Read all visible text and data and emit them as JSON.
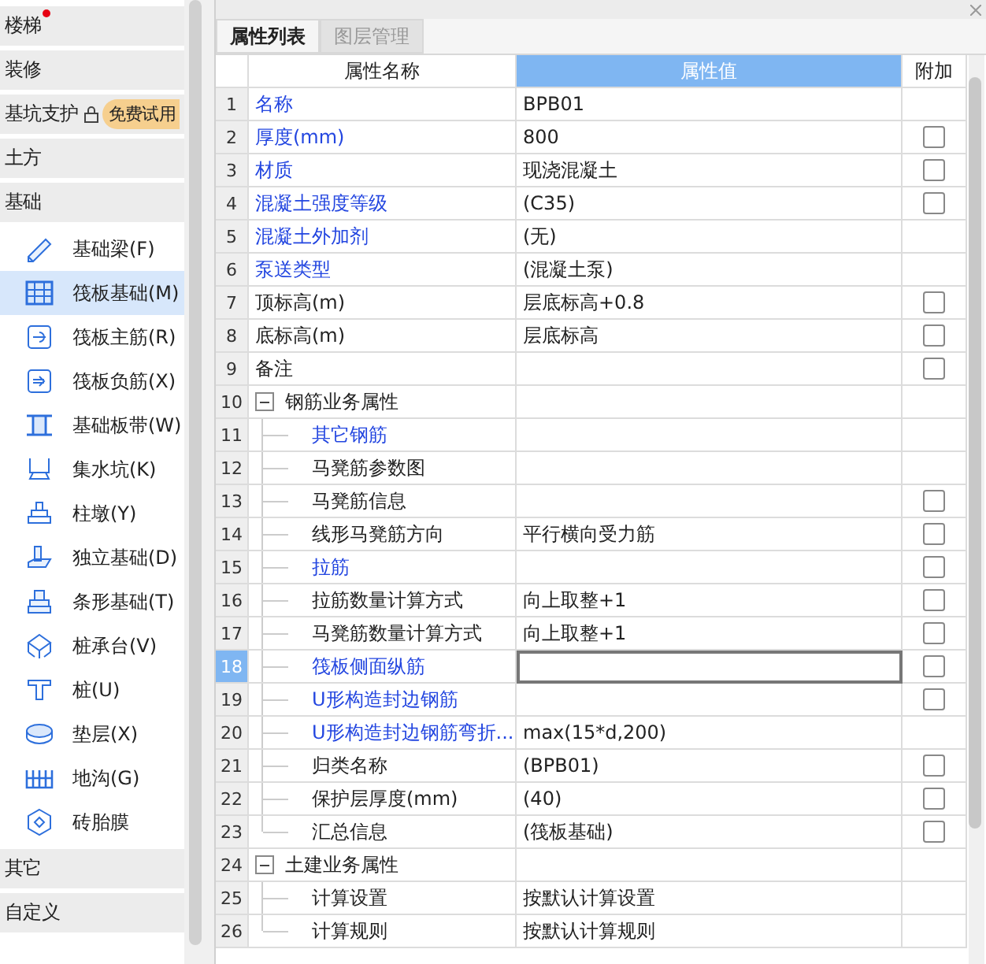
{
  "sidebar": {
    "categories": [
      {
        "label": "楼梯",
        "dot": true
      },
      {
        "label": "装修",
        "dot": false
      },
      {
        "label": "基坑支护",
        "dot": false,
        "locked": true,
        "badge": "免费试用"
      },
      {
        "label": "土方",
        "dot": false
      },
      {
        "label": "基础",
        "dot": false,
        "items": [
          {
            "label": "基础梁(F)",
            "selected": false
          },
          {
            "label": "筏板基础(M)",
            "selected": true
          },
          {
            "label": "筏板主筋(R)",
            "selected": false
          },
          {
            "label": "筏板负筋(X)",
            "selected": false
          },
          {
            "label": "基础板带(W)",
            "selected": false
          },
          {
            "label": "集水坑(K)",
            "selected": false
          },
          {
            "label": "柱墩(Y)",
            "selected": false
          },
          {
            "label": "独立基础(D)",
            "selected": false
          },
          {
            "label": "条形基础(T)",
            "selected": false
          },
          {
            "label": "桩承台(V)",
            "selected": false
          },
          {
            "label": "桩(U)",
            "selected": false
          },
          {
            "label": "垫层(X)",
            "selected": false
          },
          {
            "label": "地沟(G)",
            "selected": false
          },
          {
            "label": "砖胎膜",
            "selected": false
          }
        ]
      },
      {
        "label": "其它",
        "dot": false
      },
      {
        "label": "自定义",
        "dot": false
      }
    ]
  },
  "panel": {
    "tabs": [
      {
        "label": "属性列表",
        "selected": true
      },
      {
        "label": "图层管理",
        "selected": false
      }
    ],
    "columns": [
      "属性名称",
      "属性值",
      "附加"
    ],
    "rows": [
      {
        "num": "1",
        "name": "名称",
        "value": "BPB01",
        "color": "#2346e0",
        "selected": false
      },
      {
        "num": "2",
        "name": "厚度(mm)",
        "value": "800",
        "color": "#2346e0",
        "selected": false,
        "attach_checked": false
      },
      {
        "num": "3",
        "name": "材质",
        "value": "现浇混凝土",
        "color": "#2346e0",
        "selected": false,
        "attach_checked": false
      },
      {
        "num": "4",
        "name": "混凝土强度等级",
        "value": "(C35)",
        "color": "#2346e0",
        "selected": false,
        "attach_checked": false
      },
      {
        "num": "5",
        "name": "混凝土外加剂",
        "value": "(无)",
        "color": "#2346e0",
        "selected": false
      },
      {
        "num": "6",
        "name": "泵送类型",
        "value": "(混凝土泵)",
        "color": "#2346e0",
        "selected": false
      },
      {
        "num": "7",
        "name": "顶标高(m)",
        "value": "层底标高+0.8",
        "color": "#222222",
        "selected": false,
        "attach_checked": false
      },
      {
        "num": "8",
        "name": "底标高(m)",
        "value": "层底标高",
        "color": "#222222",
        "selected": false,
        "attach_checked": false
      },
      {
        "num": "9",
        "name": "备注",
        "color": "#222222",
        "selected": false,
        "attach_checked": false
      },
      {
        "num": "10",
        "name": "钢筋业务属性",
        "color": "#222222",
        "selected": false,
        "expanded": true,
        "children": [
          {
            "num": "11",
            "name": "其它钢筋",
            "color": "#2346e0",
            "selected": false
          },
          {
            "num": "12",
            "name": "马凳筋参数图",
            "color": "#222222",
            "selected": false
          },
          {
            "num": "13",
            "name": "马凳筋信息",
            "color": "#222222",
            "selected": false,
            "attach_checked": false
          },
          {
            "num": "14",
            "name": "线形马凳筋方向",
            "value": "平行横向受力筋",
            "color": "#222222",
            "selected": false,
            "attach_checked": false
          },
          {
            "num": "15",
            "name": "拉筋",
            "color": "#2346e0",
            "selected": false,
            "attach_checked": false
          },
          {
            "num": "16",
            "name": "拉筋数量计算方式",
            "value": "向上取整+1",
            "color": "#222222",
            "selected": false,
            "attach_checked": false
          },
          {
            "num": "17",
            "name": "马凳筋数量计算方式",
            "value": "向上取整+1",
            "color": "#222222",
            "selected": false,
            "attach_checked": false
          },
          {
            "num": "18",
            "name": "筏板侧面纵筋",
            "color": "#2346e0",
            "selected": true,
            "attach_checked": false
          },
          {
            "num": "19",
            "name": "U形构造封边钢筋",
            "color": "#2346e0",
            "selected": false,
            "attach_checked": false
          },
          {
            "num": "20",
            "name": "U形构造封边钢筋弯折...",
            "value": "max(15*d,200)",
            "color": "#2346e0",
            "selected": false
          },
          {
            "num": "21",
            "name": "归类名称",
            "value": "(BPB01)",
            "color": "#222222",
            "selected": false,
            "attach_checked": false
          },
          {
            "num": "22",
            "name": "保护层厚度(mm)",
            "value": "(40)",
            "color": "#222222",
            "selected": false,
            "attach_checked": false
          },
          {
            "num": "23",
            "name": "汇总信息",
            "value": "(筏板基础)",
            "color": "#222222",
            "selected": false,
            "attach_checked": false
          }
        ]
      },
      {
        "num": "24",
        "name": "土建业务属性",
        "color": "#222222",
        "selected": false,
        "expanded": true,
        "children": [
          {
            "num": "25",
            "name": "计算设置",
            "value": "按默认计算设置",
            "color": "#222222",
            "selected": false
          },
          {
            "num": "26",
            "name": "计算规则",
            "value": "按默认计算规则",
            "color": "#222222",
            "selected": false
          }
        ]
      }
    ]
  }
}
